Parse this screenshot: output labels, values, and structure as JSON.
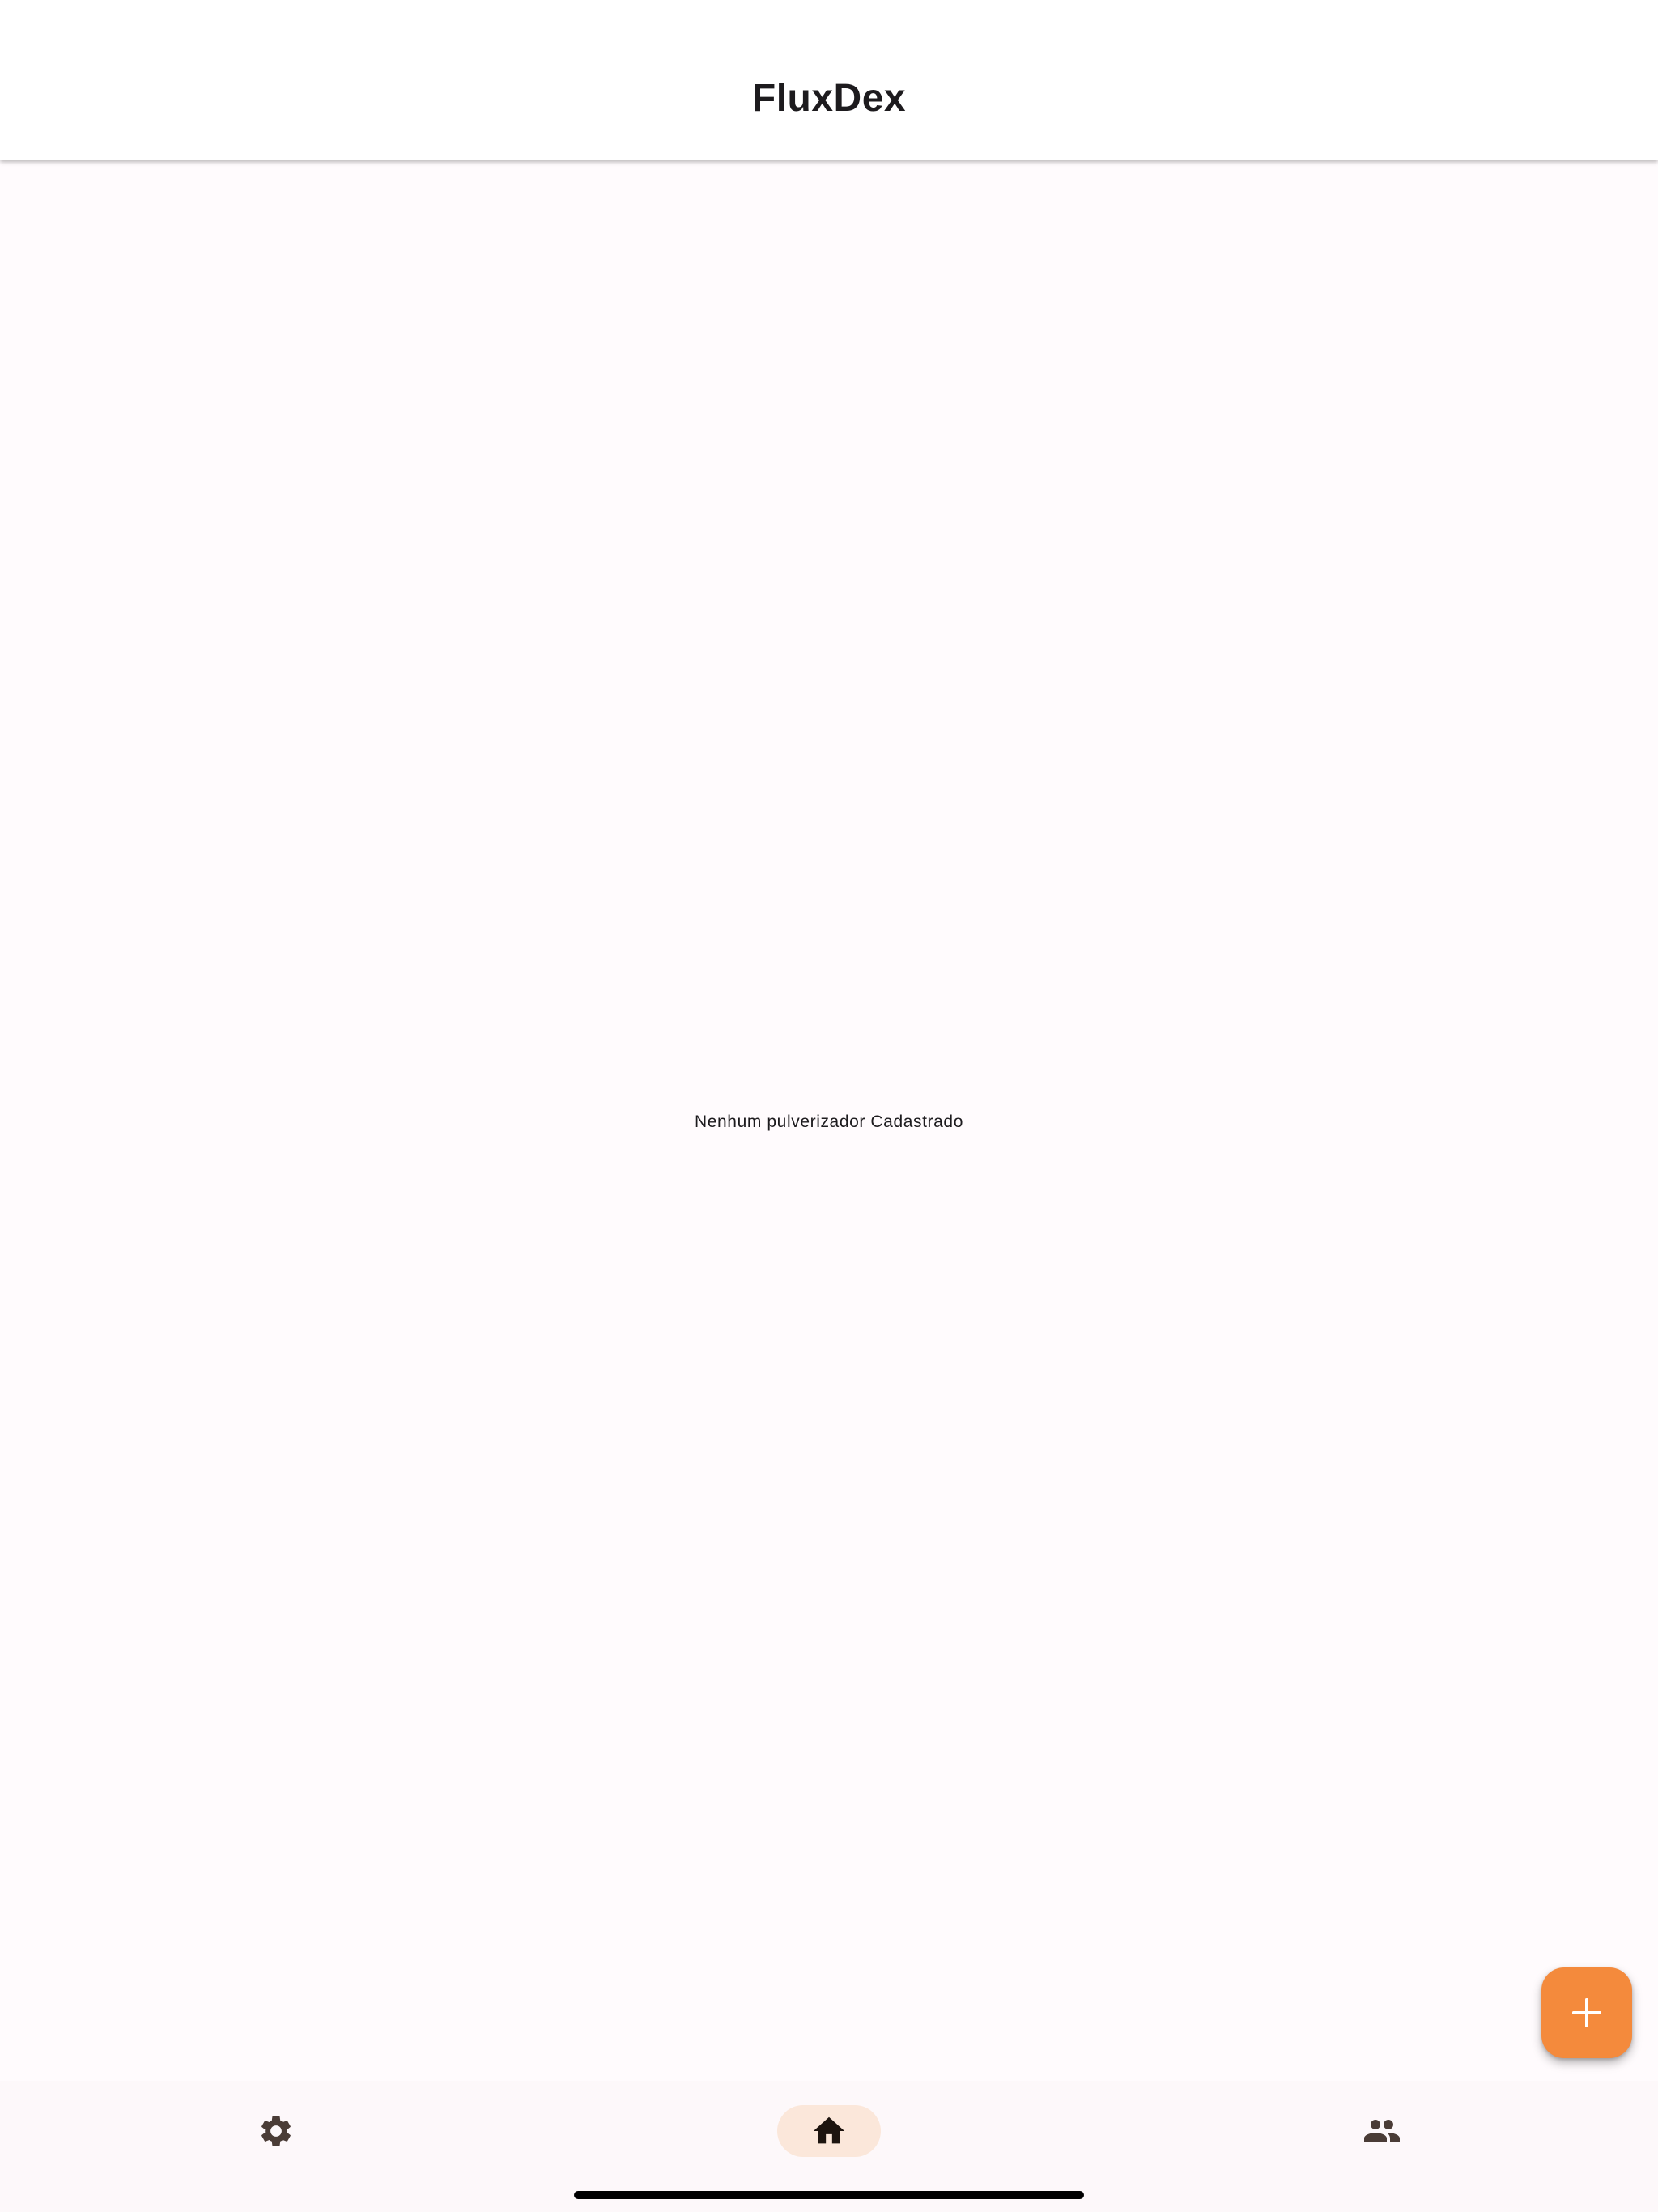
{
  "app_bar": {
    "title": "FluxDex"
  },
  "main": {
    "empty_message": "Nenhum pulverizador Cadastrado"
  },
  "fab": {
    "icon": "plus-icon",
    "color": "#f48a3c"
  },
  "bottom_nav": {
    "items": [
      {
        "icon": "gear-icon",
        "selected": false
      },
      {
        "icon": "home-icon",
        "selected": true
      },
      {
        "icon": "people-icon",
        "selected": false
      }
    ],
    "indicator_color": "#fbe7da",
    "icon_color": "#4a3c36"
  },
  "colors": {
    "background": "#fffbfd",
    "text": "#1d1b1e"
  }
}
